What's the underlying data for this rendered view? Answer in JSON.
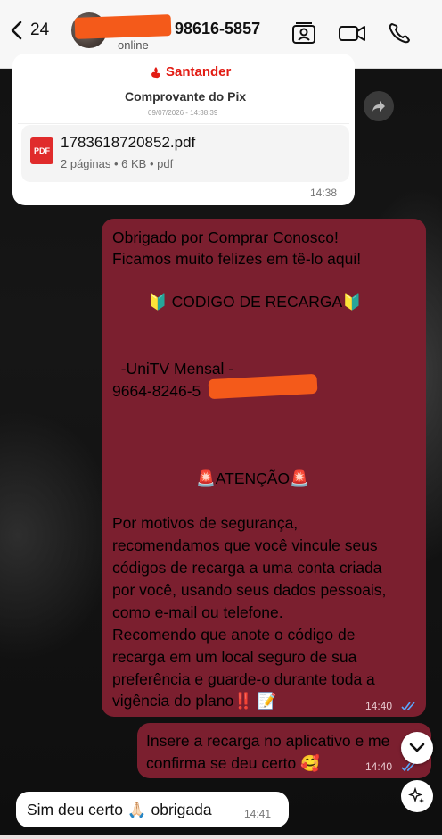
{
  "header": {
    "back_count": "24",
    "phone_suffix": "98616-5857",
    "status": "online",
    "icons": [
      "contact-card-icon",
      "video-call-icon",
      "phone-call-icon"
    ]
  },
  "messages": {
    "pdf": {
      "preview_brand": "Santander",
      "preview_title": "Comprovante do Pix",
      "preview_date": "09/07/2026 - 14:38:39",
      "file_name": "1783618720852.pdf",
      "file_meta": "2 páginas • 6 KB • pdf",
      "icon_label": "PDF",
      "time": "14:38"
    },
    "recharge": {
      "lines": [
        "Obrigado por Comprar Conosco!",
        "Ficamos muito felizes em tê-lo aqui!",
        "🔰 CODIGO DE RECARGA🔰",
        "  -UniTV Mensal -",
        "9664-8246-5",
        "🚨ATENÇÃO🚨",
        "Por motivos de segurança,",
        "recomendamos que você vincule seus",
        "códigos de recarga a uma conta criada",
        "por você, usando seus dados pessoais,",
        "como e-mail ou telefone.",
        "Recomendo que anote o código de",
        "recarga em um local seguro de sua",
        "preferência e guarde-o durante toda a",
        "vigência do plano‼️ 📝"
      ],
      "time": "14:40"
    },
    "insert": {
      "lines": [
        "Insere a recarga no aplicativo e me",
        "confirma se deu certo 🥰"
      ],
      "time": "14:40"
    },
    "reply": {
      "text": "Sim deu certo 🙏🏻 obrigada",
      "time": "14:41"
    }
  },
  "colors": {
    "outgoing_bubble": "#7b1f2f",
    "incoming_bubble": "#ffffff",
    "read_ticks": "#5aa8ff",
    "redaction": "#f45a1a"
  }
}
